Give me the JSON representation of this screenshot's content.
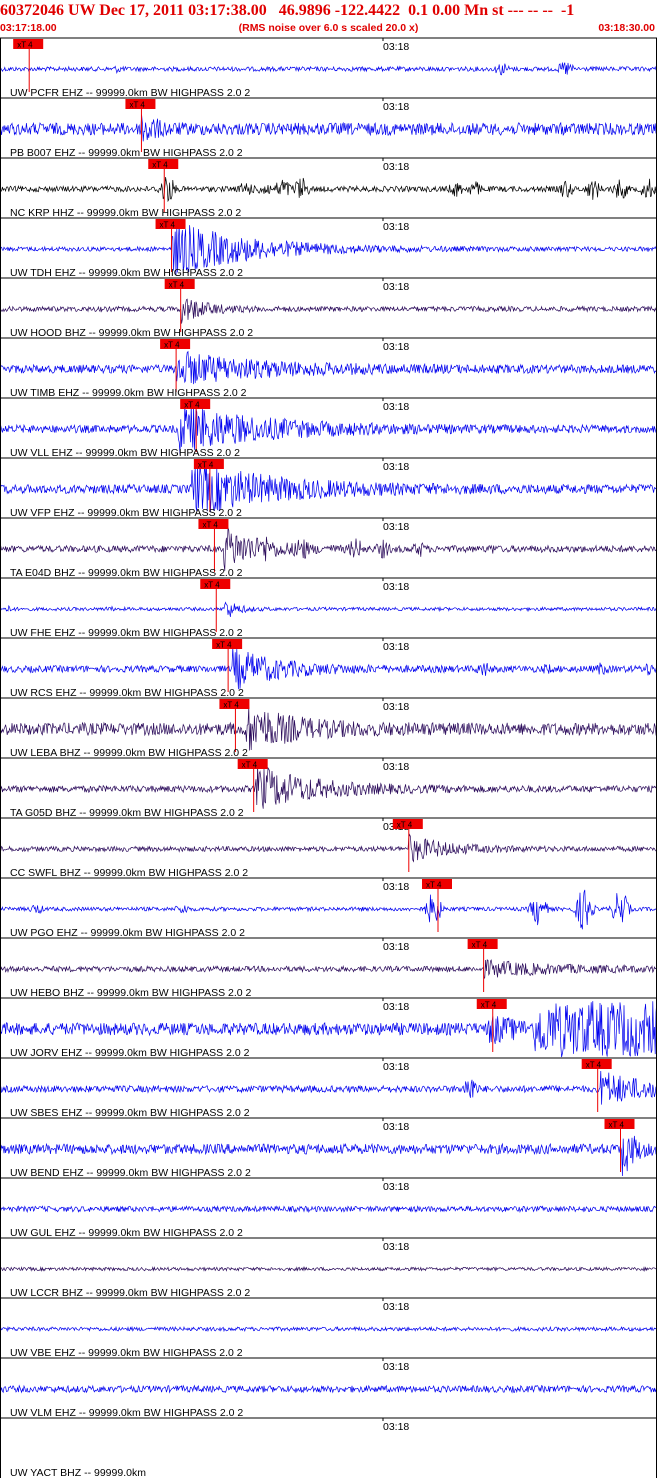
{
  "header": {
    "title": "60372046 UW Dec 17, 2011 03:17:38.00   46.9896 -122.4422  0.1 0.00 Mn st --- -- --  -1",
    "start_time": "03:17:18.00",
    "scaling_note": "(RMS noise over 6.0 s scaled 20.0 x)",
    "end_time": "03:18:30.00"
  },
  "colors": {
    "header_text": "#e00000",
    "trace_blue": "#0000ee",
    "trace_dark": "#2a0a5a",
    "trace_black": "#000000",
    "pick_box": "#ee0000",
    "separator": "#000000"
  },
  "chart_data": {
    "type": "seismogram",
    "time_range": [
      "03:17:18.00",
      "03:18:30.00"
    ],
    "minute_tick_label": "03:18",
    "pick_label": "xT 4",
    "traces": [
      {
        "label": "UW PCFR EHZ -- 99999.0km BW  HIGHPASS  2.0  2",
        "color": "blue",
        "pick_s": 3.2,
        "amp": 0.08,
        "bursts": [
          [
            13,
            0.15
          ],
          [
            55,
            0.25
          ],
          [
            62,
            0.3
          ]
        ],
        "onset": null
      },
      {
        "label": "PB B007 EHZ -- 99999.0km BW  HIGHPASS  2.0  2",
        "color": "blue",
        "pick_s": 15.5,
        "amp": 0.22,
        "bursts": [],
        "onset": [
          15.5,
          0.65,
          1.2
        ]
      },
      {
        "label": "NC KRP HHZ -- 99999.0km BW  HIGHPASS  2.0  2",
        "color": "black",
        "pick_s": 18.0,
        "amp": 0.1,
        "bursts": [
          [
            18.3,
            0.55
          ],
          [
            27,
            0.3
          ],
          [
            29,
            0.3
          ],
          [
            31,
            0.4
          ],
          [
            33,
            0.45
          ],
          [
            50,
            0.3
          ],
          [
            52,
            0.3
          ],
          [
            62,
            0.35
          ],
          [
            65,
            0.4
          ],
          [
            68,
            0.4
          ],
          [
            71,
            0.4
          ]
        ],
        "onset": null
      },
      {
        "label": "UW TDH EHZ -- 99999.0km BW  HIGHPASS  2.0  2",
        "color": "blue",
        "pick_s": 18.8,
        "amp": 0.08,
        "bursts": [],
        "onset": [
          18.8,
          1.0,
          8
        ]
      },
      {
        "label": "UW HOOD BHZ -- 99999.0km BW  HIGHPASS  2.0  2",
        "color": "dark",
        "pick_s": 19.8,
        "amp": 0.09,
        "bursts": [],
        "onset": [
          19.8,
          0.5,
          2.5
        ]
      },
      {
        "label": "UW TIMB EHZ -- 99999.0km BW  HIGHPASS  2.0  2",
        "color": "blue",
        "pick_s": 19.3,
        "amp": 0.15,
        "bursts": [],
        "onset": [
          19.3,
          0.55,
          9
        ]
      },
      {
        "label": "UW VLL EHZ -- 99999.0km BW  HIGHPASS  2.0  2",
        "color": "blue",
        "pick_s": 21.5,
        "amp": 0.14,
        "bursts": [],
        "onset": [
          19.5,
          0.85,
          9
        ]
      },
      {
        "label": "UW VFP EHZ -- 99999.0km BW  HIGHPASS  2.0  2",
        "color": "blue",
        "pick_s": 23.0,
        "amp": 0.16,
        "bursts": [],
        "onset": [
          21.0,
          0.9,
          9
        ]
      },
      {
        "label": "TA E04D BHZ -- 99999.0km BW  HIGHPASS  2.0  2",
        "color": "dark",
        "pick_s": 23.5,
        "amp": 0.12,
        "bursts": [
          [
            29,
            0.55
          ],
          [
            33,
            0.5
          ],
          [
            39,
            0.4
          ],
          [
            42,
            0.35
          ],
          [
            46,
            0.3
          ],
          [
            54,
            0.2
          ]
        ],
        "onset": [
          24.5,
          0.75,
          4
        ]
      },
      {
        "label": "UW FHE EHZ -- 99999.0km BW  HIGHPASS  2.0  2",
        "color": "blue",
        "pick_s": 23.7,
        "amp": 0.06,
        "bursts": [
          [
            1,
            0.12
          ],
          [
            12,
            0.1
          ]
        ],
        "onset": [
          24.6,
          0.4,
          1.2
        ]
      },
      {
        "label": "UW RCS EHZ -- 99999.0km BW  HIGHPASS  2.0  2",
        "color": "blue",
        "pick_s": 25.0,
        "amp": 0.12,
        "bursts": [
          [
            53,
            0.3
          ],
          [
            60,
            0.2
          ],
          [
            66,
            0.25
          ],
          [
            71,
            0.25
          ]
        ],
        "onset": [
          25.5,
          0.7,
          5
        ]
      },
      {
        "label": "UW LEBA BHZ -- 99999.0km BW  HIGHPASS  2.0  2",
        "color": "dark",
        "pick_s": 25.8,
        "amp": 0.22,
        "bursts": [],
        "onset": [
          27.0,
          0.75,
          5
        ]
      },
      {
        "label": "TA G05D BHZ -- 99999.0km BW  HIGHPASS  2.0  2",
        "color": "dark",
        "pick_s": 27.8,
        "amp": 0.12,
        "bursts": [],
        "onset": [
          28.0,
          0.8,
          6
        ]
      },
      {
        "label": "CC SWFL BHZ -- 99999.0km BW  HIGHPASS  2.0  2",
        "color": "dark",
        "pick_s": 44.8,
        "amp": 0.09,
        "bursts": [],
        "onset": [
          44.8,
          0.45,
          4
        ]
      },
      {
        "label": "UW PGO EHZ -- 99999.0km BW  HIGHPASS  2.0  2",
        "color": "blue",
        "pick_s": 48.0,
        "amp": 0.07,
        "bursts": [
          [
            4,
            0.2
          ],
          [
            20,
            0.2
          ],
          [
            47.5,
            0.6
          ],
          [
            59,
            0.6
          ],
          [
            64,
            0.8
          ],
          [
            68,
            0.7
          ]
        ],
        "onset": null
      },
      {
        "label": "UW HEBO BHZ -- 99999.0km BW  HIGHPASS  2.0  2",
        "color": "dark",
        "pick_s": 53.0,
        "amp": 0.1,
        "bursts": [],
        "onset": [
          53.0,
          0.25,
          8
        ]
      },
      {
        "label": "UW JORV EHZ -- 99999.0km BW  HIGHPASS  2.0  2",
        "color": "blue",
        "pick_s": 54.0,
        "amp": 0.22,
        "bursts": [],
        "onset": [
          53.5,
          0.45,
          3
        ],
        "saturate_from_s": 58.5
      },
      {
        "label": "UW SBES EHZ -- 99999.0km BW  HIGHPASS  2.0  2",
        "color": "blue",
        "pick_s": 65.5,
        "amp": 0.12,
        "bursts": [
          [
            51.5,
            0.5
          ]
        ],
        "onset": [
          65.8,
          0.6,
          5
        ]
      },
      {
        "label": "UW BEND EHZ -- 99999.0km BW  HIGHPASS  2.0  2",
        "color": "blue",
        "pick_s": 68.0,
        "amp": 0.18,
        "bursts": [],
        "onset": [
          68.2,
          0.95,
          1.2
        ]
      },
      {
        "label": "UW GUL EHZ -- 99999.0km BW  HIGHPASS  2.0  2",
        "color": "blue",
        "pick_s": null,
        "amp": 0.1,
        "bursts": [],
        "onset": null
      },
      {
        "label": "UW LCCR BHZ -- 99999.0km BW  HIGHPASS  2.0  2",
        "color": "dark",
        "pick_s": null,
        "amp": 0.06,
        "bursts": [],
        "onset": null
      },
      {
        "label": "UW VBE EHZ -- 99999.0km BW  HIGHPASS  2.0  2",
        "color": "blue",
        "pick_s": null,
        "amp": 0.07,
        "bursts": [],
        "onset": null
      },
      {
        "label": "UW VLM EHZ -- 99999.0km BW  HIGHPASS  2.0  2",
        "color": "blue",
        "pick_s": null,
        "amp": 0.12,
        "bursts": [],
        "onset": null
      },
      {
        "label": "UW YACT BHZ -- 99999.0km",
        "color": "blue",
        "pick_s": null,
        "amp": 0,
        "bursts": [],
        "onset": null
      }
    ]
  }
}
